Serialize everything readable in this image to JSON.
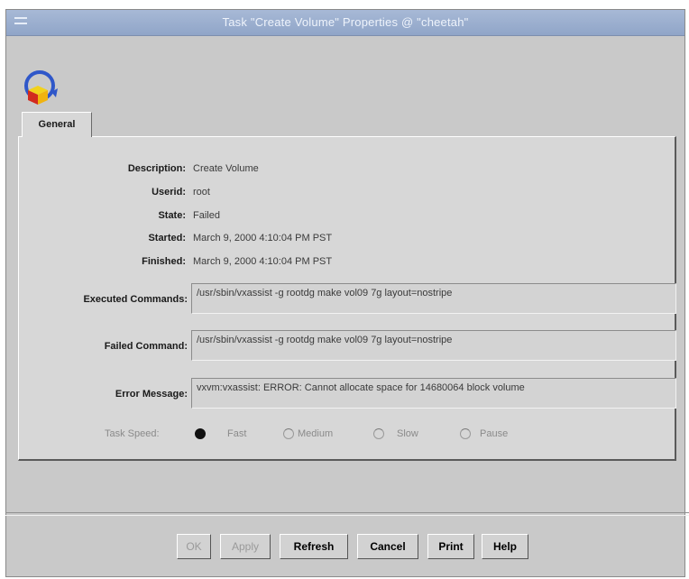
{
  "window": {
    "title": "Task \"Create Volume\" Properties @ \"cheetah\""
  },
  "tabs": [
    {
      "label": "General"
    }
  ],
  "properties": {
    "description": {
      "label": "Description:",
      "value": "Create Volume"
    },
    "userid": {
      "label": "Userid:",
      "value": "root"
    },
    "state": {
      "label": "State:",
      "value": "Failed"
    },
    "started": {
      "label": "Started:",
      "value": "March 9, 2000 4:10:04 PM PST"
    },
    "finished": {
      "label": "Finished:",
      "value": "March 9, 2000 4:10:04 PM PST"
    }
  },
  "fields": {
    "executed_commands": {
      "label": "Executed Commands:",
      "value": "/usr/sbin/vxassist -g rootdg  make vol09 7g layout=nostripe"
    },
    "failed_command": {
      "label": "Failed Command:",
      "value": "/usr/sbin/vxassist -g rootdg  make vol09 7g layout=nostripe"
    },
    "error_message": {
      "label": "Error Message:",
      "value": "vxvm:vxassist: ERROR: Cannot allocate space for 14680064 block volume"
    }
  },
  "task_speed": {
    "label": "Task Speed:",
    "options": [
      "Fast",
      "Medium",
      "Slow",
      "Pause"
    ],
    "selected": "Fast"
  },
  "buttons": {
    "ok": "OK",
    "apply": "Apply",
    "refresh": "Refresh",
    "cancel": "Cancel",
    "print": "Print",
    "help": "Help"
  },
  "colors": {
    "titlebar": "#9bb0d0",
    "window_bg": "#c9c9c9",
    "panel_bg": "#d7d7d7"
  }
}
